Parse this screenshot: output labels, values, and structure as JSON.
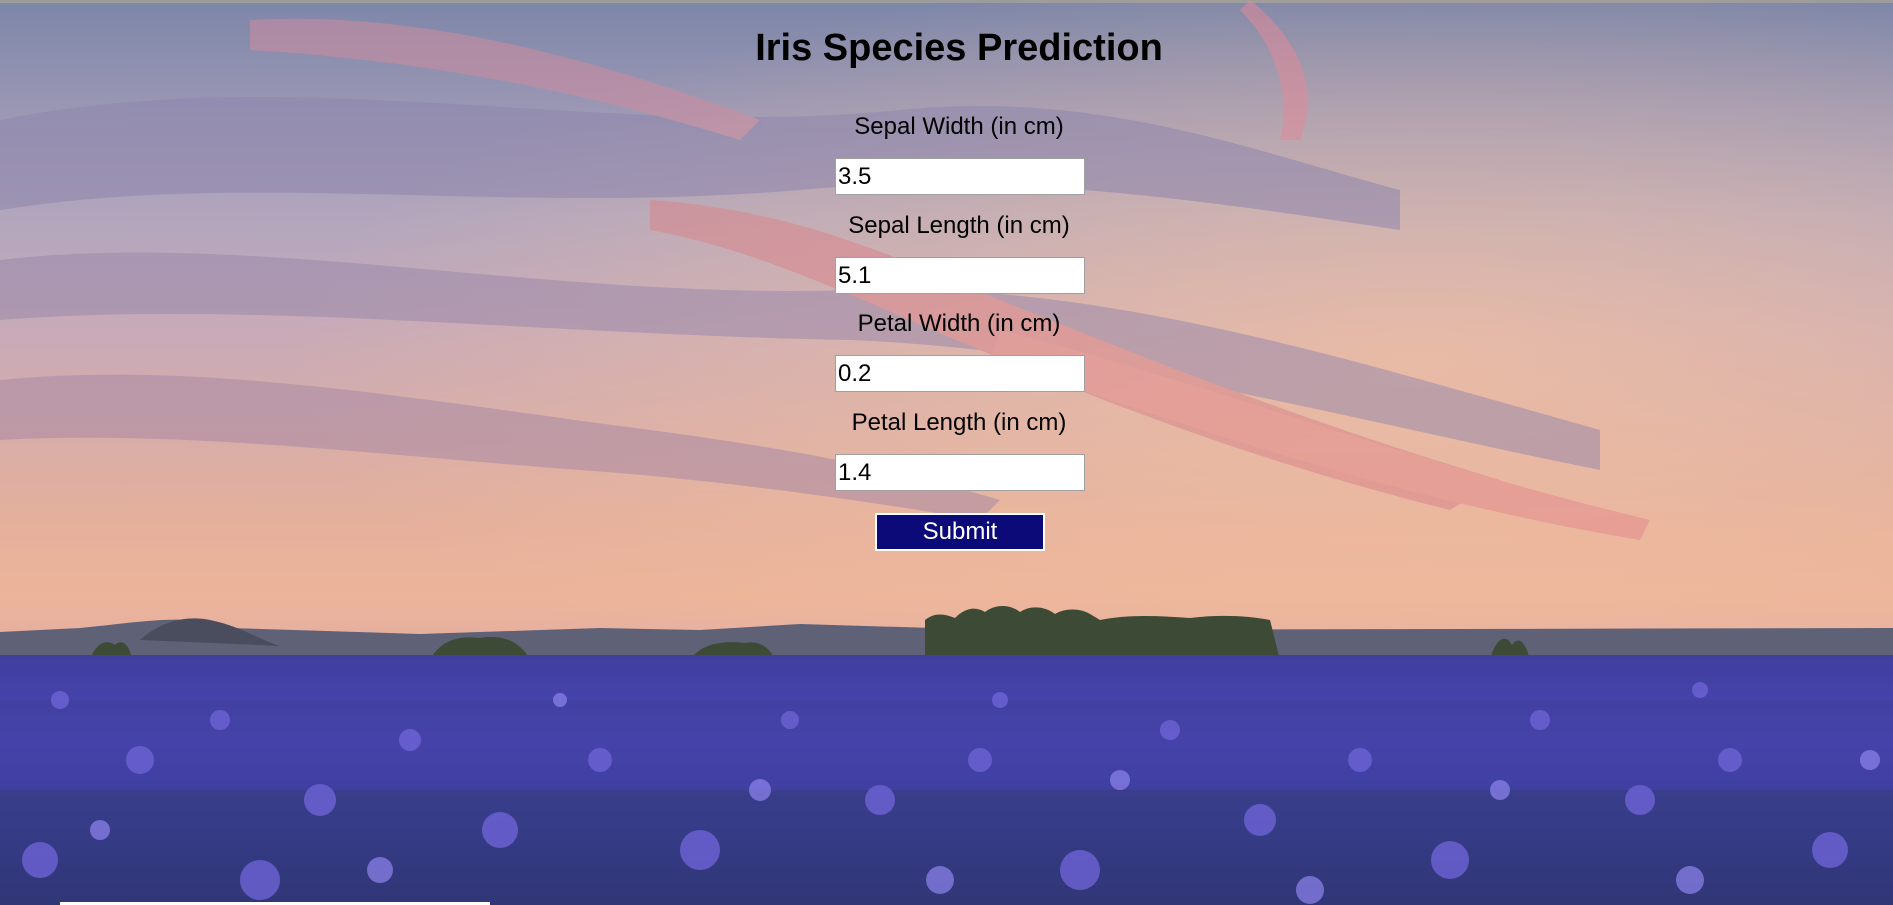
{
  "page": {
    "title": "Iris Species Prediction"
  },
  "form": {
    "fields": [
      {
        "label": "Sepal Width (in cm)",
        "value": "3.5"
      },
      {
        "label": "Sepal Length (in cm)",
        "value": "5.1"
      },
      {
        "label": "Petal Width (in cm)",
        "value": "0.2"
      },
      {
        "label": "Petal Length (in cm)",
        "value": "1.4"
      }
    ],
    "submit_label": "Submit"
  },
  "colors": {
    "submit_background": "#0b0a78",
    "submit_text": "#ffffff"
  }
}
